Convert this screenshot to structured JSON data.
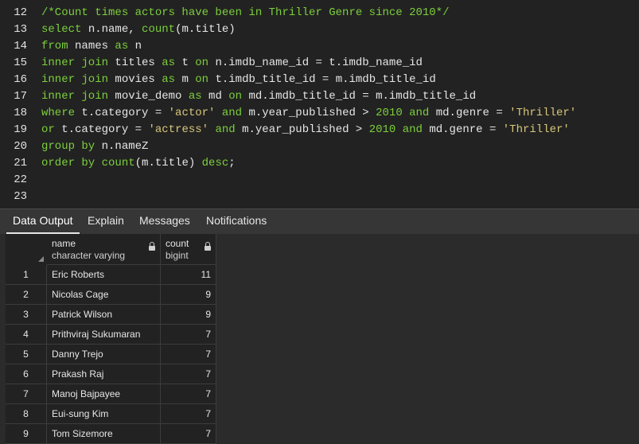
{
  "editor": {
    "lines": [
      {
        "n": "12",
        "tokens": [
          {
            "t": "/*Count times actors have been in Thriller Genre since 2010*/",
            "c": "cmt"
          }
        ]
      },
      {
        "n": "13",
        "tokens": [
          {
            "t": "select",
            "c": "kw"
          },
          {
            "t": " n.name, ",
            "c": "op"
          },
          {
            "t": "count",
            "c": "fn"
          },
          {
            "t": "(m.title)",
            "c": "op"
          }
        ]
      },
      {
        "n": "14",
        "tokens": [
          {
            "t": "from",
            "c": "kw"
          },
          {
            "t": " names ",
            "c": "op"
          },
          {
            "t": "as",
            "c": "kw"
          },
          {
            "t": " n",
            "c": "op"
          }
        ]
      },
      {
        "n": "15",
        "tokens": [
          {
            "t": "inner join",
            "c": "kw"
          },
          {
            "t": " titles ",
            "c": "op"
          },
          {
            "t": "as",
            "c": "kw"
          },
          {
            "t": " t ",
            "c": "op"
          },
          {
            "t": "on",
            "c": "kw"
          },
          {
            "t": " n.imdb_name_id = t.imdb_name_id",
            "c": "op"
          }
        ]
      },
      {
        "n": "16",
        "tokens": [
          {
            "t": "inner join",
            "c": "kw"
          },
          {
            "t": " movies ",
            "c": "op"
          },
          {
            "t": "as",
            "c": "kw"
          },
          {
            "t": " m ",
            "c": "op"
          },
          {
            "t": "on",
            "c": "kw"
          },
          {
            "t": " t.imdb_title_id = m.imdb_title_id",
            "c": "op"
          }
        ]
      },
      {
        "n": "17",
        "tokens": [
          {
            "t": "inner join",
            "c": "kw"
          },
          {
            "t": " movie_demo ",
            "c": "op"
          },
          {
            "t": "as",
            "c": "kw"
          },
          {
            "t": " md ",
            "c": "op"
          },
          {
            "t": "on",
            "c": "kw"
          },
          {
            "t": " md.imdb_title_id = m.imdb_title_id",
            "c": "op"
          }
        ]
      },
      {
        "n": "18",
        "tokens": [
          {
            "t": "where",
            "c": "kw"
          },
          {
            "t": " t.category = ",
            "c": "op"
          },
          {
            "t": "'actor'",
            "c": "str"
          },
          {
            "t": " ",
            "c": "op"
          },
          {
            "t": "and",
            "c": "kw"
          },
          {
            "t": " m.year_published > ",
            "c": "op"
          },
          {
            "t": "2010",
            "c": "num"
          },
          {
            "t": " ",
            "c": "op"
          },
          {
            "t": "and",
            "c": "kw"
          },
          {
            "t": " md.genre = ",
            "c": "op"
          },
          {
            "t": "'Thriller'",
            "c": "str"
          }
        ]
      },
      {
        "n": "19",
        "tokens": [
          {
            "t": "or",
            "c": "kw"
          },
          {
            "t": " t.category = ",
            "c": "op"
          },
          {
            "t": "'actress'",
            "c": "str"
          },
          {
            "t": " ",
            "c": "op"
          },
          {
            "t": "and",
            "c": "kw"
          },
          {
            "t": " m.year_published > ",
            "c": "op"
          },
          {
            "t": "2010",
            "c": "num"
          },
          {
            "t": " ",
            "c": "op"
          },
          {
            "t": "and",
            "c": "kw"
          },
          {
            "t": " md.genre = ",
            "c": "op"
          },
          {
            "t": "'Thriller'",
            "c": "str"
          }
        ]
      },
      {
        "n": "20",
        "tokens": [
          {
            "t": "group by",
            "c": "kw"
          },
          {
            "t": " n.nameZ",
            "c": "op"
          }
        ]
      },
      {
        "n": "21",
        "tokens": [
          {
            "t": "order by",
            "c": "kw"
          },
          {
            "t": " ",
            "c": "op"
          },
          {
            "t": "count",
            "c": "fn"
          },
          {
            "t": "(m.title) ",
            "c": "op"
          },
          {
            "t": "desc",
            "c": "kw"
          },
          {
            "t": ";",
            "c": "op"
          }
        ]
      },
      {
        "n": "22",
        "tokens": []
      },
      {
        "n": "23",
        "tokens": []
      }
    ]
  },
  "tabs": [
    {
      "label": "Data Output",
      "active": true
    },
    {
      "label": "Explain",
      "active": false
    },
    {
      "label": "Messages",
      "active": false
    },
    {
      "label": "Notifications",
      "active": false
    }
  ],
  "grid": {
    "columns": [
      {
        "name": "name",
        "type": "character varying"
      },
      {
        "name": "count",
        "type": "bigint"
      }
    ],
    "rows": [
      {
        "idx": "1",
        "name": "Eric Roberts",
        "count": "11"
      },
      {
        "idx": "2",
        "name": "Nicolas Cage",
        "count": "9"
      },
      {
        "idx": "3",
        "name": "Patrick Wilson",
        "count": "9"
      },
      {
        "idx": "4",
        "name": "Prithviraj Sukumaran",
        "count": "7"
      },
      {
        "idx": "5",
        "name": "Danny Trejo",
        "count": "7"
      },
      {
        "idx": "6",
        "name": "Prakash Raj",
        "count": "7"
      },
      {
        "idx": "7",
        "name": "Manoj Bajpayee",
        "count": "7"
      },
      {
        "idx": "8",
        "name": "Eui-sung Kim",
        "count": "7"
      },
      {
        "idx": "9",
        "name": "Tom Sizemore",
        "count": "7"
      }
    ]
  }
}
